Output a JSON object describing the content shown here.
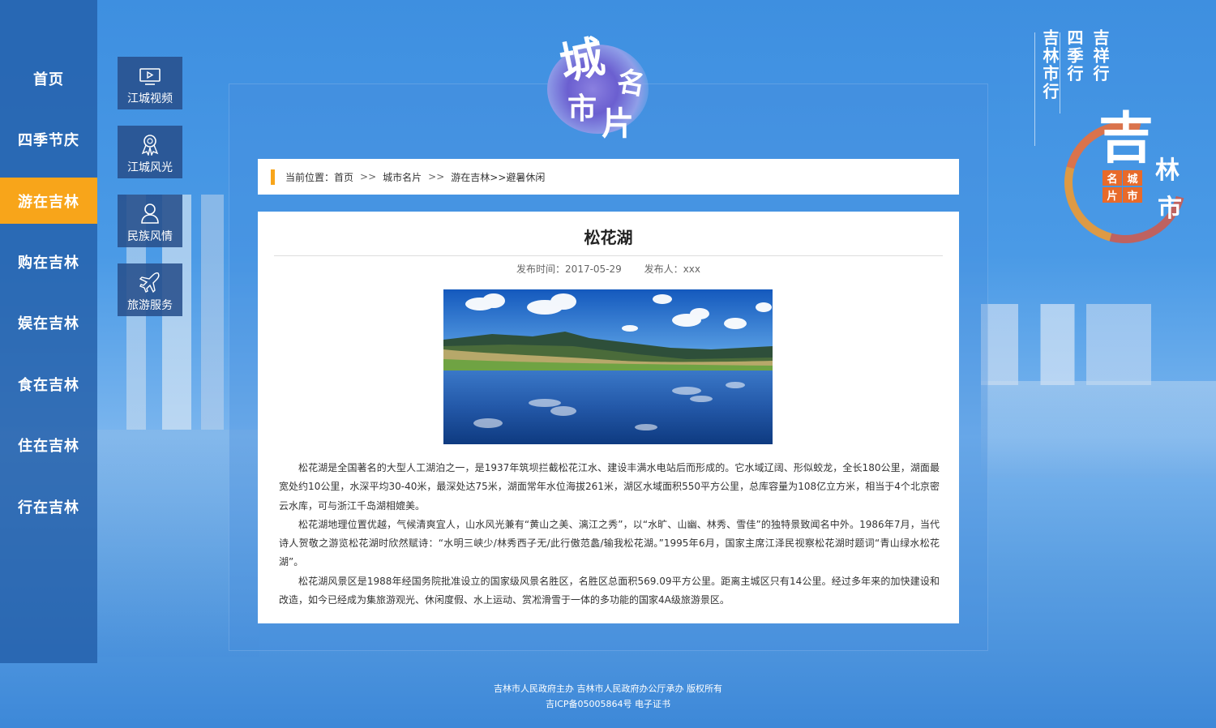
{
  "left_nav": {
    "items": [
      {
        "label": "首页",
        "active": false
      },
      {
        "label": "四季节庆",
        "active": false
      },
      {
        "label": "游在吉林",
        "active": true
      },
      {
        "label": "购在吉林",
        "active": false
      },
      {
        "label": "娱在吉林",
        "active": false
      },
      {
        "label": "食在吉林",
        "active": false
      },
      {
        "label": "住在吉林",
        "active": false
      },
      {
        "label": "行在吉林",
        "active": false
      }
    ],
    "active_color": "#f8a51a"
  },
  "sub_nav": {
    "items": [
      {
        "label": "江城视频",
        "icon": "monitor-icon"
      },
      {
        "label": "江城风光",
        "icon": "award-ribbon-icon"
      },
      {
        "label": "民族风情",
        "icon": "person-icon"
      },
      {
        "label": "旅游服务",
        "icon": "airplane-icon"
      }
    ]
  },
  "logo": {
    "chars": [
      "城",
      "市",
      "名",
      "片"
    ]
  },
  "badge": {
    "columns": [
      "吉祥行",
      "四季行",
      "吉林市行"
    ],
    "big_char": "吉",
    "small_chars": [
      "林",
      "市"
    ],
    "seal_chars": [
      "名",
      "城",
      "片",
      "市"
    ],
    "ring_color": "#f06e32"
  },
  "breadcrumb": {
    "prefix": "当前位置：",
    "items": [
      "首页",
      "城市名片",
      "游在吉林>>避暑休闲"
    ],
    "separator": ">>"
  },
  "article": {
    "title": "松花湖",
    "publish_time": "发布时间：2017-05-29",
    "publisher": "发布人：xxx",
    "paragraphs": [
      "松花湖是全国著名的大型人工湖泊之一，是1937年筑坝拦截松花江水、建设丰满水电站后而形成的。它水域辽阔、形似蛟龙，全长180公里，湖面最宽处约10公里，水深平均30-40米，最深处达75米，湖面常年水位海拔261米，湖区水域面积550平方公里，总库容量为108亿立方米，相当于4个北京密云水库，可与浙江千岛湖相媲美。",
      "松花湖地理位置优越，气候清爽宜人，山水风光兼有“黄山之美、漓江之秀”，以“水旷、山幽、林秀、雪佳”的独特景致闻名中外。1986年7月，当代诗人贺敬之游览松花湖时欣然赋诗：“水明三峡少/林秀西子无/此行傲范蠡/输我松花湖。”1995年6月，国家主席江泽民视察松花湖时题词“青山绿水松花湖”。",
      "松花湖风景区是1988年经国务院批准设立的国家级风景名胜区，名胜区总面积569.09平方公里。距离主城区只有14公里。经过多年来的加快建设和改造，如今已经成为集旅游观光、休闲度假、水上运动、赏凇滑雪于一体的多功能的国家4A级旅游景区。"
    ]
  },
  "footer": {
    "line1": "吉林市人民政府主办  吉林市人民政府办公厅承办  版权所有",
    "line2": "吉ICP备05005864号  电子证书"
  }
}
